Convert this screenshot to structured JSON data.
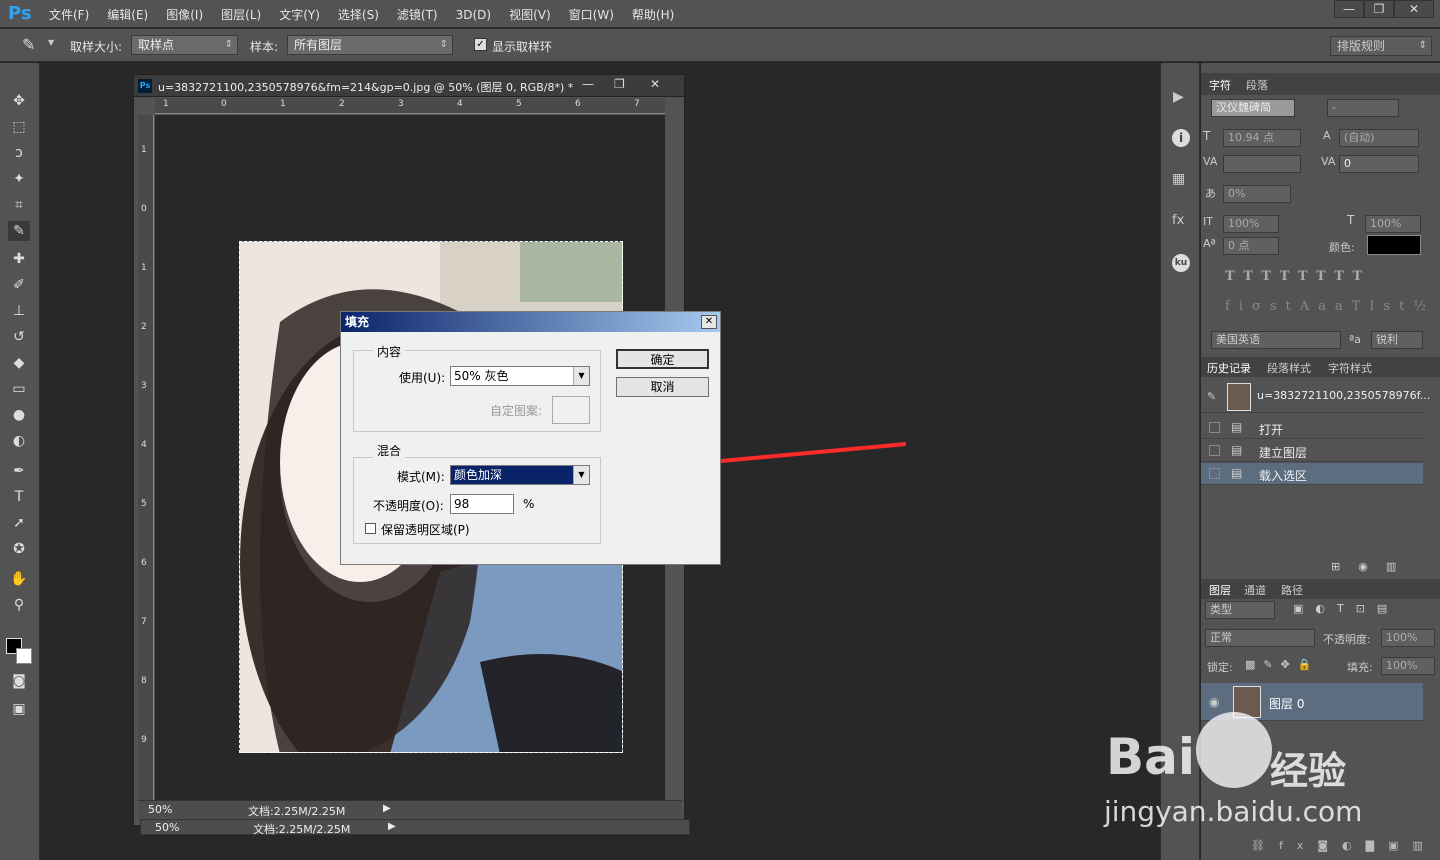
{
  "app": {
    "logo": "Ps"
  },
  "menu": [
    "文件(F)",
    "编辑(E)",
    "图像(I)",
    "图层(L)",
    "文字(Y)",
    "选择(S)",
    "滤镜(T)",
    "3D(D)",
    "视图(V)",
    "窗口(W)",
    "帮助(H)"
  ],
  "window_controls": [
    "—",
    "❐",
    "✕"
  ],
  "options": {
    "sample_size_label": "取样大小:",
    "sample_size_value": "取样点",
    "sample_label": "样本:",
    "sample_value": "所有图层",
    "show_ring_label": "显示取样环",
    "workspace": "排版规则"
  },
  "document": {
    "title": "u=3832721100,2350578976&fm=214&gp=0.jpg @ 50% (图层 0, RGB/8*) *",
    "ruler_top": [
      "1",
      "0",
      "1",
      "2",
      "3",
      "4",
      "5",
      "6",
      "7"
    ],
    "ruler_left": [
      "1",
      "0",
      "1",
      "2",
      "3",
      "4",
      "5",
      "6",
      "7",
      "8",
      "9"
    ],
    "zoom": "50%",
    "doc_info": "文档:2.25M/2.25M",
    "zoom2": "50%",
    "doc_info2": "文档:2.25M/2.25M"
  },
  "dialog": {
    "title": "填充",
    "content_group": "内容",
    "use_label": "使用(U):",
    "use_value": "50% 灰色",
    "custom_pattern_label": "自定图案:",
    "blend_group": "混合",
    "mode_label": "模式(M):",
    "mode_value": "颜色加深",
    "opacity_label": "不透明度(O):",
    "opacity_value": "98",
    "percent": "%",
    "preserve_label": "保留透明区域(P)",
    "ok": "确定",
    "cancel": "取消"
  },
  "char_panel": {
    "tabs": [
      "字符",
      "段落"
    ],
    "font_family": "汉仪魏碑简",
    "font_style": "-",
    "font_size": "10.94 点",
    "leading": "(自动)",
    "tracking": "0",
    "kerning": "",
    "scale_h": "0%",
    "scale_v": "100%",
    "scale_v2": "100%",
    "baseline": "0 点",
    "color_label": "颜色:",
    "language": "美国英语",
    "aa": "锐利",
    "aa_icon": "ªa"
  },
  "history_panel": {
    "tabs": [
      "历史记录",
      "段落样式",
      "字符样式"
    ],
    "snapshot": "u=3832721100,2350578976f...",
    "items": [
      "打开",
      "建立图层",
      "载入选区"
    ]
  },
  "layers_panel": {
    "tabs": [
      "图层",
      "通道",
      "路径"
    ],
    "filter": "类型",
    "blend_mode": "正常",
    "opacity_label": "不透明度:",
    "opacity": "100%",
    "lock_label": "锁定:",
    "fill_label": "填充:",
    "fill": "100%",
    "layer_name": "图层 0"
  },
  "watermark": {
    "brand": "Bai",
    "brand2": "经验",
    "url": "jingyan.baidu.com"
  },
  "colors": {
    "accent": "#2fa3ef",
    "arrow": "#ff2a2a",
    "dialog_title": "#0a246a",
    "selected": "#5d6d80"
  }
}
